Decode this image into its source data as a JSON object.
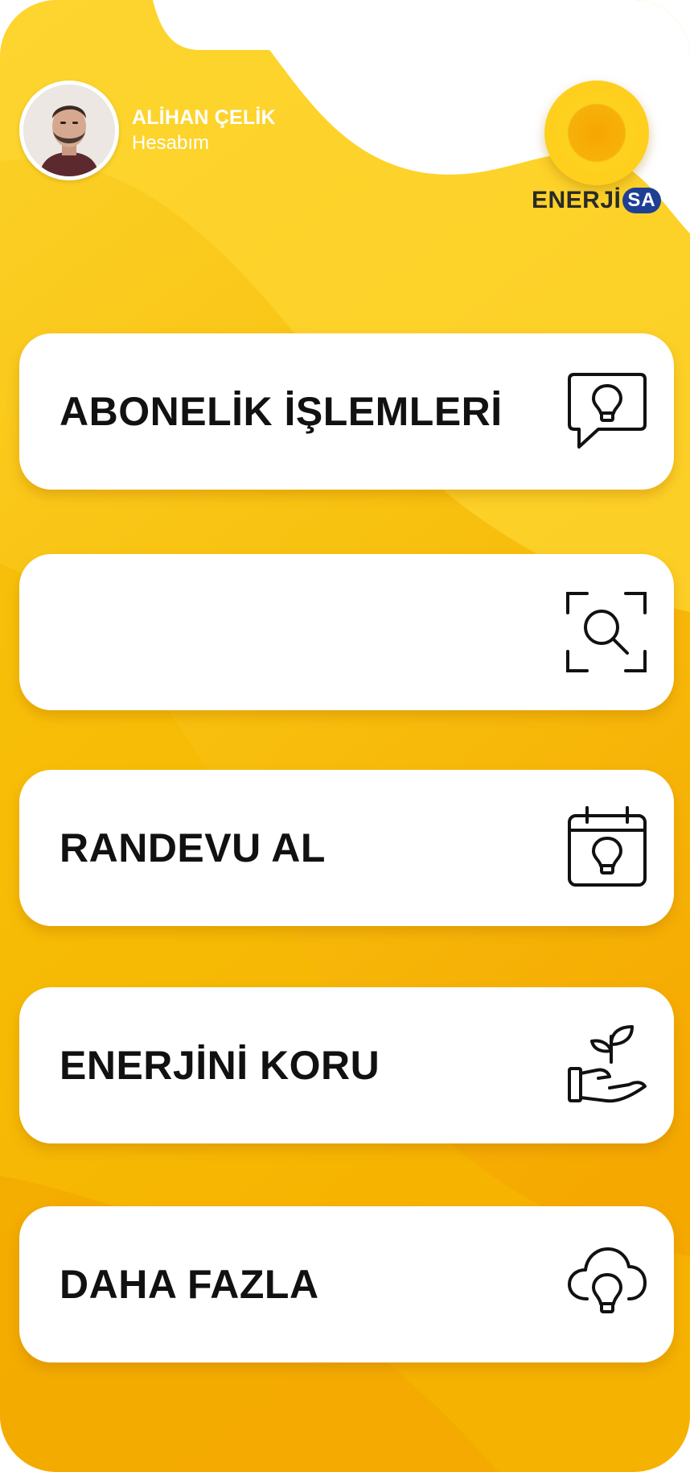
{
  "profile": {
    "name": "ALİHAN ÇELİK",
    "account_link": "Hesabım"
  },
  "logo": {
    "word_main": "ENERJ",
    "word_i": "İ",
    "badge": "SA",
    "badge_color": "#1f3f95",
    "sun_color": "#fdd21f"
  },
  "menu": [
    {
      "label": "ABONELİK İŞLEMLERİ",
      "icon": "chat-bulb-icon"
    },
    {
      "label": "",
      "icon": "scan-search-icon"
    },
    {
      "label": "RANDEVU AL",
      "icon": "calendar-bulb-icon"
    },
    {
      "label": "ENERJİNİ KORU",
      "icon": "hand-sprout-icon"
    },
    {
      "label": "DAHA FAZLA",
      "icon": "cloud-bulb-icon"
    }
  ],
  "colors": {
    "background_light": "#fdd62a",
    "background_mid": "#f8c20c",
    "background_deep": "#f5a700",
    "card": "#ffffff",
    "text": "#111111"
  }
}
